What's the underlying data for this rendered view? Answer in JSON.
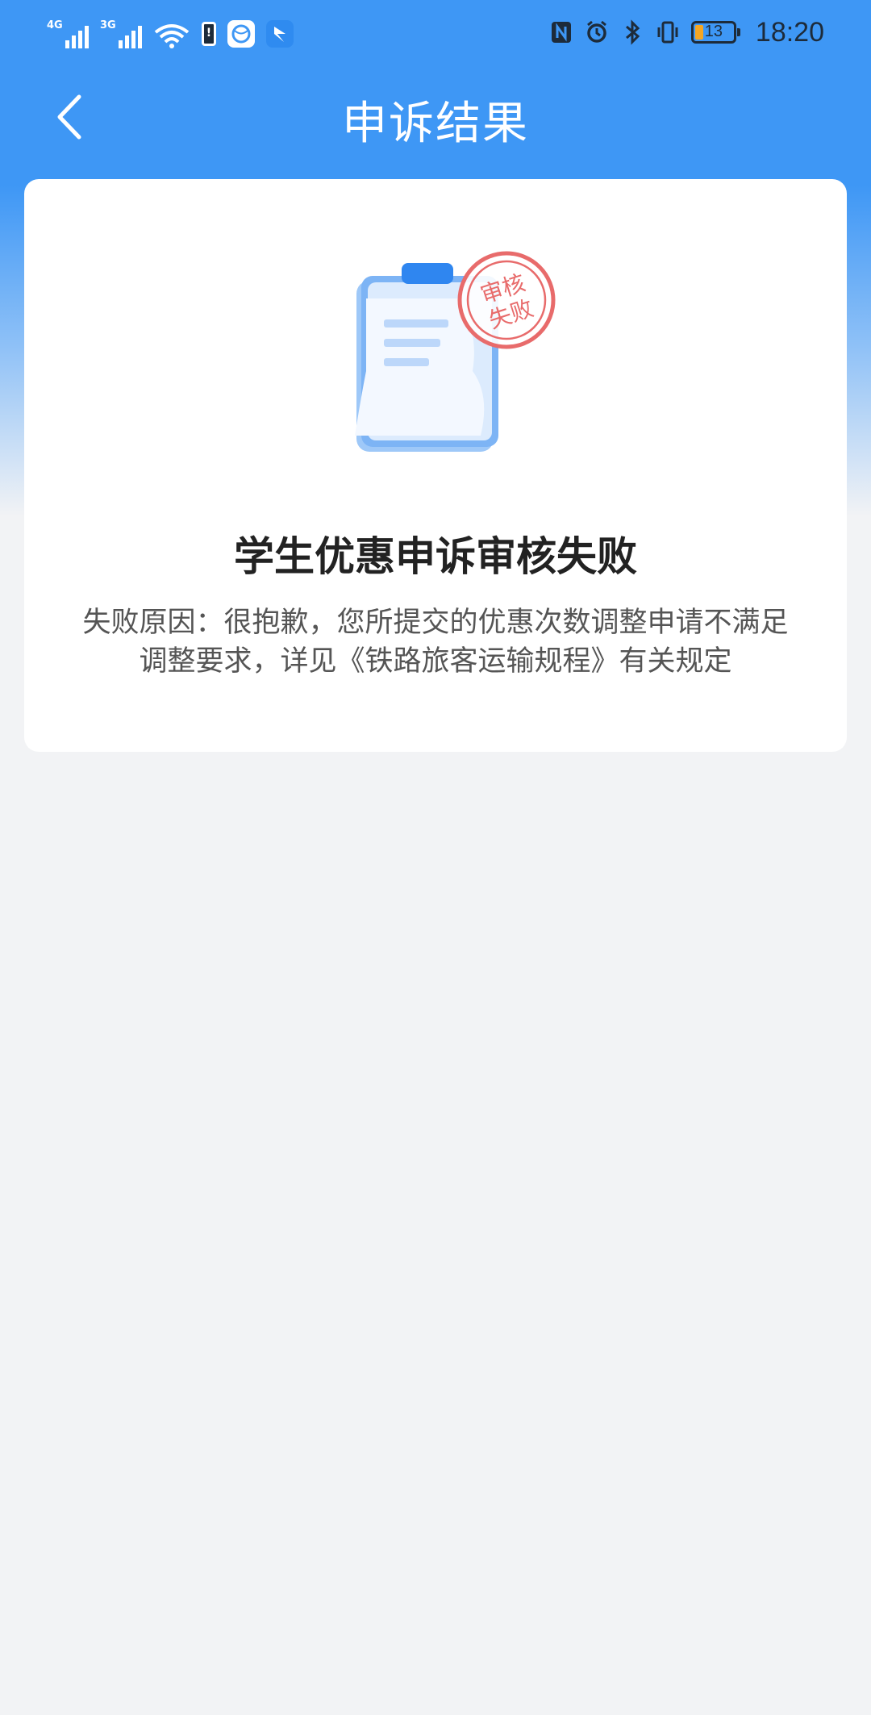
{
  "status_bar": {
    "signal1_label": "4G",
    "signal2_label": "3G",
    "battery_warn_glyph": "!",
    "battery_level": "13",
    "time": "18:20",
    "icons": [
      "signal-4g-icon",
      "signal-3g-icon",
      "wifi-icon",
      "battery-warning-icon",
      "browser-app-icon",
      "bird-app-icon",
      "nfc-icon",
      "alarm-icon",
      "bluetooth-icon",
      "vibrate-icon",
      "battery-icon"
    ]
  },
  "header": {
    "title": "申诉结果",
    "back_icon": "chevron-left-icon"
  },
  "result": {
    "stamp_line1": "审核",
    "stamp_line2": "失败",
    "title": "学生优惠申诉审核失败",
    "reason_line1": "失败原因：很抱歉，您所提交的优惠次数调整申请不满足",
    "reason_line2": "调整要求，详见《铁路旅客运输规程》有关规定"
  },
  "colors": {
    "brand_blue": "#3e97f5",
    "background": "#f2f3f5",
    "stamp_red": "#e86b6b",
    "title_text": "#222222",
    "body_text": "#555555"
  }
}
